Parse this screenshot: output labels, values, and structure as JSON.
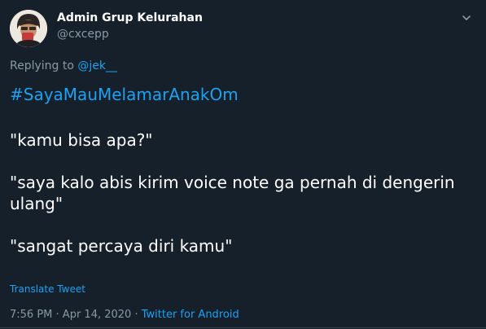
{
  "author": {
    "display_name": "Admin Grup Kelurahan",
    "handle": "@cxcepp"
  },
  "reply": {
    "prefix": "Replying to",
    "target": "@jek__"
  },
  "tweet": {
    "hashtag": "#SayaMauMelamarAnakOm",
    "lines": [
      "\"kamu bisa apa?\"",
      "\"saya kalo abis kirim voice note ga pernah di dengerin ulang\"",
      "\"sangat percaya diri kamu\""
    ]
  },
  "translate_label": "Translate Tweet",
  "meta": {
    "time": "7:56 PM",
    "separator": " · ",
    "date": "Apr 14, 2020",
    "source": "Twitter for Android"
  },
  "icons": {
    "avatar": "avatar-photo",
    "caret": "chevron-down-icon"
  },
  "colors": {
    "background": "#15202b",
    "accent": "#1da1f2",
    "muted": "#8899a6"
  }
}
